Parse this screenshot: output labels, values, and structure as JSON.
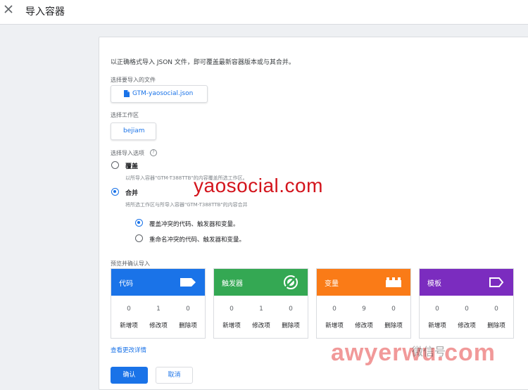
{
  "header": {
    "title": "导入容器",
    "close_icon": "close-icon"
  },
  "intro": "以正确格式导入 JSON 文件，即可覆盖最新容器版本或与其合并。",
  "file": {
    "label": "选择要导入的文件",
    "name": "GTM-yaosocial.json",
    "icon": "document-icon"
  },
  "workspace": {
    "label": "选择工作区",
    "name": "bejiam"
  },
  "import_options": {
    "label": "选择导入选项",
    "help_icon": "help-icon",
    "overwrite": {
      "title": "覆盖",
      "desc": "以所导入容器\"GTM-T388TTB\"的内容覆盖所选工作区。",
      "selected": false
    },
    "merge": {
      "title": "合并",
      "desc": "将所选工作区与所导入容器\"GTM-T388TTB\"的内容合并",
      "selected": true
    },
    "merge_options": [
      {
        "label": "覆盖冲突的代码、触发器和变量。",
        "selected": true
      },
      {
        "label": "重命名冲突的代码、触发器和变量。",
        "selected": false
      }
    ]
  },
  "preview": {
    "label": "预览并确认导入",
    "column_labels": [
      "新增项",
      "修改项",
      "删除项"
    ],
    "tiles": [
      {
        "name": "代码",
        "color": "#1a73e8",
        "icon": "tag-icon",
        "values": [
          "0",
          "1",
          "0"
        ]
      },
      {
        "name": "触发器",
        "color": "#34a853",
        "icon": "trigger-icon",
        "values": [
          "0",
          "1",
          "0"
        ]
      },
      {
        "name": "变量",
        "color": "#fa7b17",
        "icon": "variable-icon",
        "values": [
          "0",
          "9",
          "0"
        ]
      },
      {
        "name": "模板",
        "color": "#7b2cbf",
        "icon": "template-icon",
        "values": [
          "0",
          "0",
          "0"
        ]
      }
    ],
    "details_link": "查看更改详情"
  },
  "actions": {
    "confirm": "确认",
    "cancel": "取消"
  },
  "watermarks": {
    "site": "yaosocial.com",
    "brand": "awyerwu.com",
    "wechat": "微信号"
  }
}
